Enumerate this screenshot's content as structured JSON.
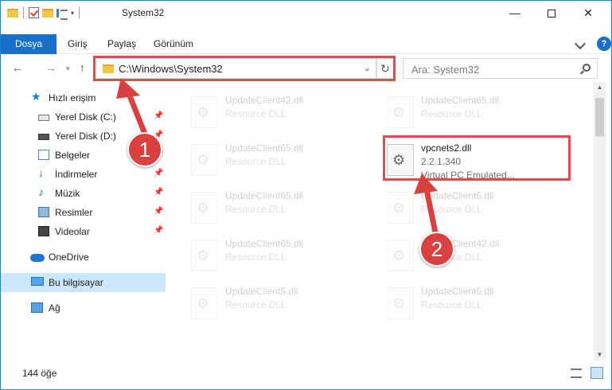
{
  "window": {
    "title": "System32",
    "controls": {
      "minimize": "—",
      "close": "✕"
    }
  },
  "ribbon": {
    "tabs": [
      "Dosya",
      "Giriş",
      "Paylaş",
      "Görünüm"
    ],
    "help": "?"
  },
  "nav": {
    "back": "←",
    "forward": "→",
    "recent": "▾",
    "up": "↑",
    "address": "C:\\Windows\\System32",
    "address_dropdown": "⌄",
    "refresh": "↻",
    "search_placeholder": "Ara: System32"
  },
  "sidebar": {
    "items": [
      {
        "label": "Hızlı erişim",
        "icon": "star-icon",
        "pinned": false
      },
      {
        "label": "Yerel Disk (C:)",
        "icon": "drive-icon",
        "pinned": true
      },
      {
        "label": "Yerel Disk (D:)",
        "icon": "drive-icon",
        "pinned": true
      },
      {
        "label": "Belgeler",
        "icon": "documents-icon",
        "pinned": true
      },
      {
        "label": "İndirmeler",
        "icon": "download-icon",
        "pinned": true
      },
      {
        "label": "Müzik",
        "icon": "music-icon",
        "pinned": true
      },
      {
        "label": "Resimler",
        "icon": "pictures-icon",
        "pinned": true
      },
      {
        "label": "Videolar",
        "icon": "video-icon",
        "pinned": true
      },
      {
        "label": "OneDrive",
        "icon": "onedrive-icon",
        "pinned": false
      },
      {
        "label": "Bu bilgisayar",
        "icon": "pc-icon",
        "pinned": false,
        "selected": true
      },
      {
        "label": "Ağ",
        "icon": "network-icon",
        "pinned": false
      }
    ],
    "pin_glyph": "📌"
  },
  "files": {
    "left": [
      {
        "name": "UpdateClient42.dll",
        "type": "Resource DLL"
      },
      {
        "name": "UpdateClient65.dll",
        "type": "Resource DLL"
      },
      {
        "name": "UpdateClient65.dll",
        "type": "Resource DLL"
      },
      {
        "name": "UpdateClient65.dll",
        "type": "Resource DLL"
      },
      {
        "name": "UpdateClient5.dll",
        "type": "Resource DLL"
      }
    ],
    "right": [
      {
        "name": "UpdateClient65.dll",
        "type": "Resource DLL"
      },
      {
        "name": "vpcnets2.dll",
        "version": "2.2.1.340",
        "description": "Virtual PC Emulated..."
      },
      {
        "name": "UpdateClient5.dll",
        "type": "Resource DLL"
      },
      {
        "name": "UpdateClient42.dll",
        "type": "Resource DLL"
      },
      {
        "name": "UpdateClient5.dll",
        "type": "Resource DLL"
      }
    ]
  },
  "status": {
    "count": "144 öğe"
  },
  "annotations": {
    "marker1": "1",
    "marker2": "2",
    "color": "#d94141"
  },
  "colors": {
    "accent": "#1a6fc9",
    "selection": "#cce8ff",
    "callout": "#d94f4f"
  }
}
